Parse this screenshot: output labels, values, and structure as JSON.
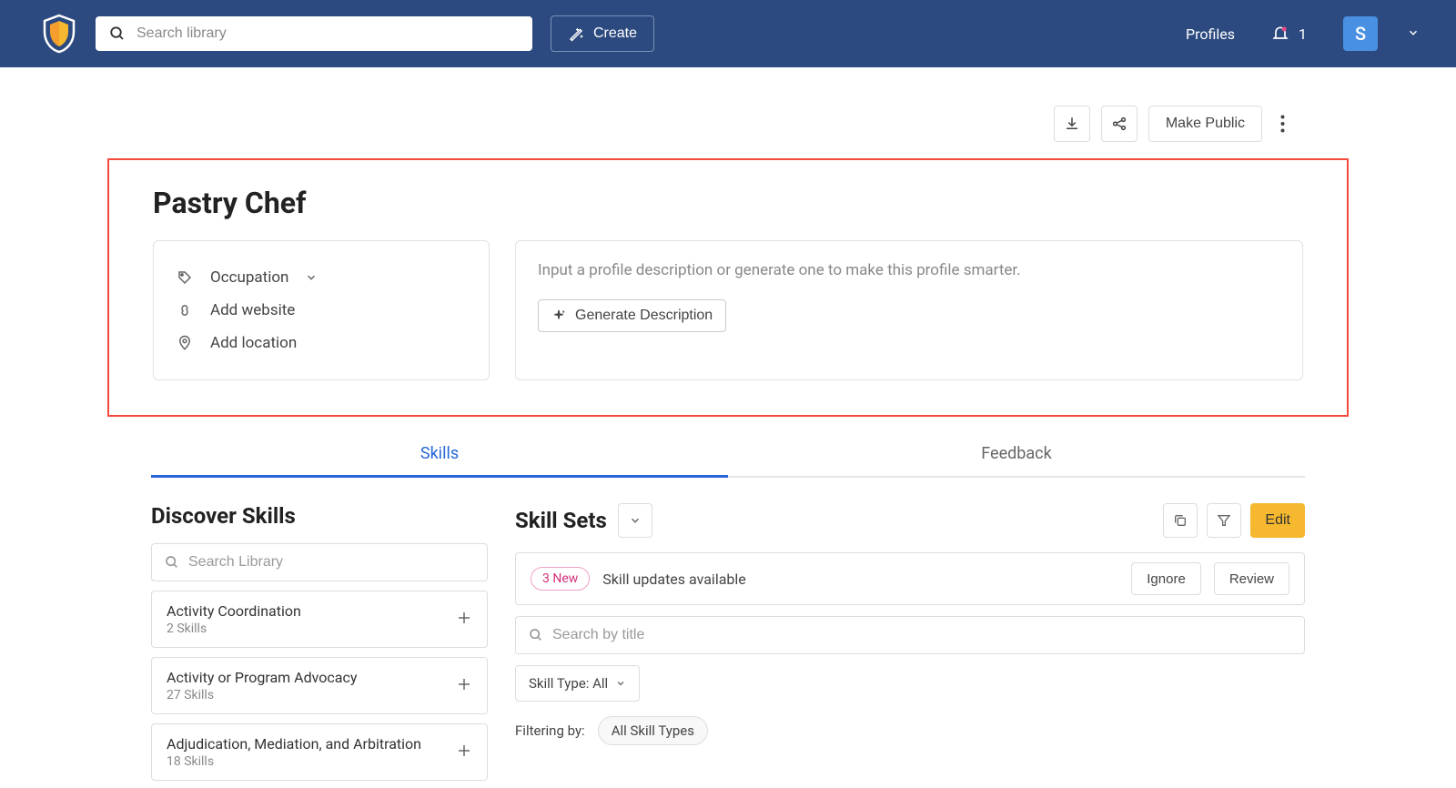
{
  "header": {
    "search_placeholder": "Search library",
    "create_label": "Create",
    "profiles_link": "Profiles",
    "notif_count": "1",
    "avatar_initial": "S"
  },
  "actions": {
    "make_public": "Make Public"
  },
  "hero": {
    "title": "Pastry Chef",
    "occupation_label": "Occupation",
    "add_website": "Add website",
    "add_location": "Add location",
    "desc_placeholder": "Input a profile description or generate one to make this profile smarter.",
    "generate_btn": "Generate Description"
  },
  "tabs": {
    "skills": "Skills",
    "feedback": "Feedback"
  },
  "discover": {
    "title": "Discover Skills",
    "search_placeholder": "Search Library",
    "items": [
      {
        "name": "Activity Coordination",
        "count": "2 Skills"
      },
      {
        "name": "Activity or Program Advocacy",
        "count": "27 Skills"
      },
      {
        "name": "Adjudication, Mediation, and Arbitration",
        "count": "18 Skills"
      }
    ]
  },
  "skillsets": {
    "title": "Skill Sets",
    "edit": "Edit",
    "updates_badge": "3 New",
    "updates_text": "Skill updates available",
    "ignore": "Ignore",
    "review": "Review",
    "search_placeholder": "Search by title",
    "type_filter": "Skill Type: All",
    "filtering_by": "Filtering by:",
    "chip": "All Skill Types"
  }
}
